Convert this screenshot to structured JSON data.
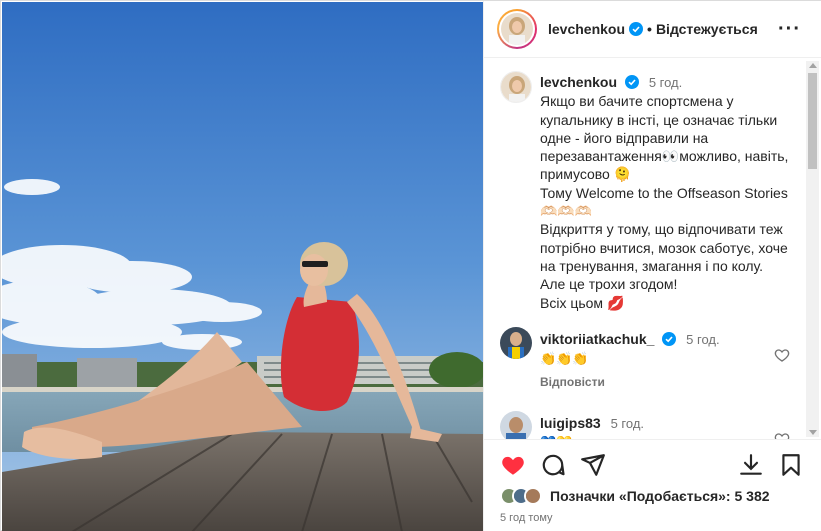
{
  "header": {
    "username": "levchenkou",
    "separator": "•",
    "follow_state": "Відстежується",
    "more_icon": "more-horizontal-icon"
  },
  "caption": {
    "username": "levchenkou",
    "time": "5 год.",
    "lines": [
      "Якщо ви бачите спортсмена у купальнику в інсті, це означає тільки одне - його відправили на перезавантаження👀можливо, навіть, примусово 🫠",
      "Тому Welcome to the Offseason Stories 🫶🏻🫶🏻🫶🏻",
      "Відкриття у тому, що відпочивати теж потрібно вчитися, мозок саботує, хоче на тренування, змагання і по колу. Але це трохи згодом!",
      "Всіх цьом 💋"
    ]
  },
  "comments": [
    {
      "username": "viktoriiatkachuk_",
      "time": "5 год.",
      "text": "👏👏👏",
      "reply": "Відповісти"
    },
    {
      "username": "luigips83",
      "time": "5 год.",
      "text": "💙💛"
    }
  ],
  "actions": {
    "like_icon": "heart-filled-icon",
    "comment_icon": "comment-icon",
    "share_icon": "send-icon",
    "download_icon": "download-icon",
    "save_icon": "bookmark-icon",
    "like_color": "#ff3040"
  },
  "likes": {
    "label": "Позначки «Подобається»: 5 382"
  },
  "posted_time": "5 год тому",
  "colors": {
    "text": "#262626",
    "secondary": "#737373",
    "verified": "#0095f6",
    "border": "#dbdbdb"
  }
}
